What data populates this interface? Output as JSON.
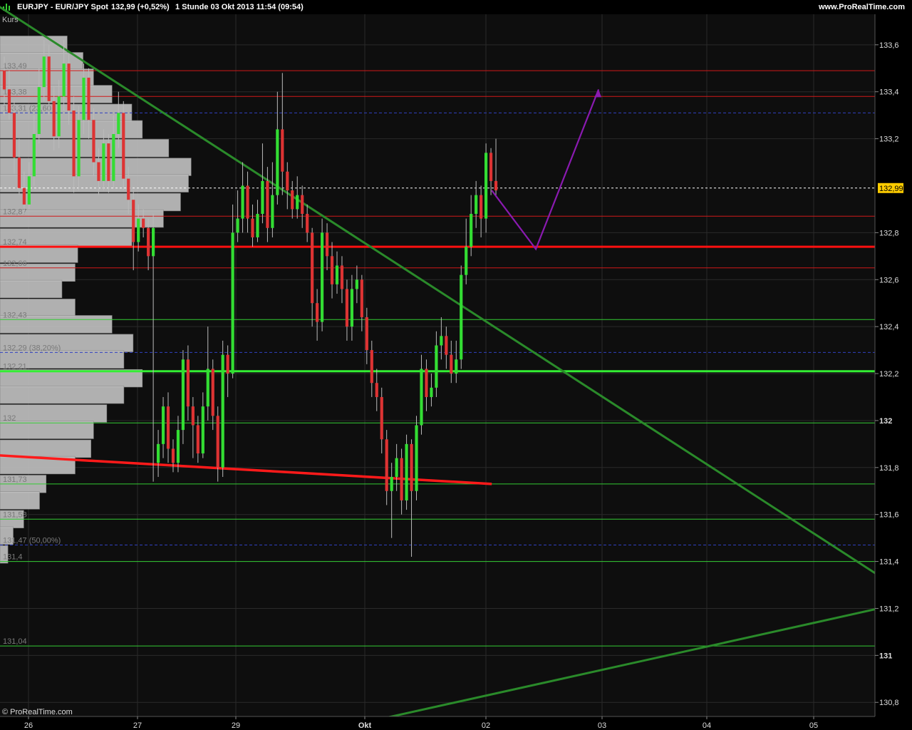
{
  "header": {
    "symbol": "EURJPY - EUR/JPY Spot",
    "price": "132,99 (+0,52%)",
    "timeframe": "1 Stunde  03 Okt 2013 11:54 (09:54)",
    "site": "www.ProRealTime.com"
  },
  "footer": {
    "copyright": "© ProRealTime.com"
  },
  "indicator_label": "Kurs",
  "colors": {
    "background": "#0e0e0e",
    "up_candle": "#33dd33",
    "down_candle": "#dd3333",
    "resistance": "#ff1a1a",
    "support": "#33dd33",
    "trendline": "#2a8a2a",
    "projection": "#8a1ab0",
    "price_tag": "#ffcc00"
  },
  "chart_data": {
    "type": "candlestick",
    "instrument": "EURJPY",
    "timeframe": "1 Stunde",
    "ylim": [
      130.74,
      133.73
    ],
    "y_ticks": [
      "133,6",
      "133,4",
      "133,2",
      "132,8",
      "132,6",
      "132,4",
      "132,2",
      "132",
      "131,8",
      "131,6",
      "131,4",
      "131,2",
      "131",
      "130,8"
    ],
    "x_ticks": [
      {
        "label": "26",
        "day": 0
      },
      {
        "label": "27",
        "day": 1
      },
      {
        "label": "29",
        "day": 2
      },
      {
        "label": "Okt",
        "day": 3
      },
      {
        "label": "02",
        "day": 4
      },
      {
        "label": "03",
        "day": 5
      },
      {
        "label": "04",
        "day": 6
      },
      {
        "label": "05",
        "day": 7
      }
    ],
    "last_price": {
      "label": "132,99",
      "value": 132.99
    },
    "candles": [
      [
        133.49,
        133.41,
        133.55,
        133.3
      ],
      [
        133.41,
        133.31,
        133.49,
        133.28
      ],
      [
        133.31,
        133.12,
        133.36,
        133.05
      ],
      [
        133.12,
        132.99,
        133.2,
        132.96
      ],
      [
        132.99,
        132.92,
        133.06,
        132.88
      ],
      [
        132.92,
        133.04,
        133.1,
        132.9
      ],
      [
        133.04,
        133.22,
        133.3,
        133.0
      ],
      [
        133.22,
        133.42,
        133.5,
        133.18
      ],
      [
        133.42,
        133.55,
        133.62,
        133.36
      ],
      [
        133.55,
        133.36,
        133.6,
        133.3
      ],
      [
        133.36,
        133.21,
        133.42,
        133.15
      ],
      [
        133.21,
        133.38,
        133.45,
        133.16
      ],
      [
        133.38,
        133.52,
        133.62,
        133.32
      ],
      [
        133.52,
        133.32,
        133.56,
        133.26
      ],
      [
        133.32,
        133.04,
        133.38,
        132.97
      ],
      [
        133.04,
        133.28,
        133.34,
        132.98
      ],
      [
        133.28,
        133.46,
        133.52,
        133.22
      ],
      [
        133.46,
        133.28,
        133.5,
        133.2
      ],
      [
        133.28,
        133.1,
        133.33,
        133.04
      ],
      [
        133.1,
        133.02,
        133.16,
        132.96
      ],
      [
        133.02,
        133.18,
        133.24,
        132.98
      ],
      [
        133.18,
        133.02,
        133.22,
        132.97
      ],
      [
        133.02,
        133.22,
        133.3,
        132.99
      ],
      [
        133.22,
        133.31,
        133.4,
        133.16
      ],
      [
        133.31,
        133.03,
        133.36,
        132.98
      ],
      [
        133.03,
        132.94,
        133.08,
        132.88
      ],
      [
        132.94,
        132.76,
        132.98,
        132.64
      ],
      [
        132.76,
        132.86,
        132.92,
        132.72
      ],
      [
        132.86,
        132.82,
        132.9,
        132.78
      ],
      [
        132.82,
        132.7,
        132.86,
        132.64
      ],
      [
        132.7,
        132.82,
        132.88,
        131.74
      ],
      [
        131.82,
        131.9,
        131.96,
        131.76
      ],
      [
        131.9,
        132.06,
        132.1,
        131.84
      ],
      [
        132.06,
        131.88,
        132.12,
        131.82
      ],
      [
        131.88,
        131.82,
        131.92,
        131.78
      ],
      [
        131.82,
        131.96,
        132.02,
        131.78
      ],
      [
        131.96,
        132.26,
        132.3,
        131.9
      ],
      [
        132.26,
        132.06,
        132.32,
        132.0
      ],
      [
        132.06,
        131.98,
        132.1,
        131.84
      ],
      [
        131.98,
        131.86,
        132.02,
        131.82
      ],
      [
        131.86,
        132.06,
        132.12,
        131.84
      ],
      [
        132.06,
        132.22,
        132.4,
        132.0
      ],
      [
        132.22,
        132.02,
        132.26,
        131.96
      ],
      [
        132.02,
        131.8,
        132.06,
        131.74
      ],
      [
        131.8,
        132.28,
        132.34,
        131.76
      ],
      [
        132.28,
        132.2,
        132.32,
        132.1
      ],
      [
        132.2,
        132.8,
        132.92,
        132.18
      ],
      [
        132.8,
        132.86,
        132.98,
        132.76
      ],
      [
        132.86,
        133.0,
        133.1,
        132.8
      ],
      [
        133.0,
        132.86,
        133.06,
        132.8
      ],
      [
        132.86,
        132.78,
        132.92,
        132.74
      ],
      [
        132.78,
        132.88,
        132.94,
        132.76
      ],
      [
        132.88,
        133.02,
        133.18,
        132.84
      ],
      [
        133.02,
        132.82,
        133.08,
        132.76
      ],
      [
        132.82,
        132.96,
        133.1,
        132.78
      ],
      [
        132.96,
        133.24,
        133.4,
        132.92
      ],
      [
        133.24,
        133.06,
        133.48,
        132.96
      ],
      [
        133.06,
        132.98,
        133.1,
        132.9
      ],
      [
        132.98,
        132.9,
        133.02,
        132.86
      ],
      [
        132.9,
        132.96,
        133.04,
        132.86
      ],
      [
        132.96,
        132.88,
        133.0,
        132.82
      ],
      [
        132.88,
        132.8,
        132.92,
        132.76
      ],
      [
        132.8,
        132.5,
        132.82,
        132.4
      ],
      [
        132.5,
        132.42,
        132.56,
        132.34
      ],
      [
        132.42,
        132.8,
        132.86,
        132.38
      ],
      [
        132.8,
        132.7,
        132.84,
        132.64
      ],
      [
        132.7,
        132.58,
        132.76,
        132.52
      ],
      [
        132.58,
        132.66,
        132.72,
        132.54
      ],
      [
        132.66,
        132.56,
        132.7,
        132.5
      ],
      [
        132.56,
        132.4,
        132.6,
        132.34
      ],
      [
        132.4,
        132.56,
        132.62,
        132.34
      ],
      [
        132.56,
        132.6,
        132.66,
        132.5
      ],
      [
        132.6,
        132.44,
        132.62,
        132.38
      ],
      [
        132.44,
        132.3,
        132.48,
        132.24
      ],
      [
        132.3,
        132.16,
        132.34,
        132.1
      ],
      [
        132.16,
        132.1,
        132.22,
        132.04
      ],
      [
        132.1,
        131.92,
        132.14,
        131.86
      ],
      [
        131.92,
        131.7,
        131.96,
        131.64
      ],
      [
        131.7,
        131.76,
        131.82,
        131.5
      ],
      [
        131.76,
        131.84,
        131.9,
        131.7
      ],
      [
        131.84,
        131.66,
        131.88,
        131.6
      ],
      [
        131.66,
        131.9,
        131.94,
        131.62
      ],
      [
        131.9,
        131.7,
        131.92,
        131.42
      ],
      [
        131.7,
        131.98,
        132.02,
        131.66
      ],
      [
        131.98,
        132.22,
        132.28,
        131.94
      ],
      [
        132.22,
        132.1,
        132.26,
        132.04
      ],
      [
        132.1,
        132.14,
        132.2,
        132.06
      ],
      [
        132.14,
        132.32,
        132.38,
        132.1
      ],
      [
        132.32,
        132.36,
        132.44,
        132.26
      ],
      [
        132.36,
        132.28,
        132.4,
        132.22
      ],
      [
        132.28,
        132.2,
        132.34,
        132.16
      ],
      [
        132.2,
        132.26,
        132.34,
        132.16
      ],
      [
        132.26,
        132.62,
        132.66,
        132.22
      ],
      [
        132.62,
        132.74,
        132.86,
        132.58
      ],
      [
        132.74,
        132.88,
        132.96,
        132.7
      ],
      [
        132.88,
        132.96,
        133.02,
        132.82
      ],
      [
        132.96,
        132.86,
        133.0,
        132.78
      ],
      [
        132.86,
        133.14,
        133.18,
        132.8
      ],
      [
        133.14,
        133.02,
        133.16,
        132.96
      ],
      [
        133.02,
        132.98,
        133.2,
        132.96
      ]
    ],
    "horizontal_levels": [
      {
        "value": 133.49,
        "kind": "resistance",
        "label": "133,49"
      },
      {
        "value": 133.38,
        "kind": "resistance",
        "label": "133,38"
      },
      {
        "value": 133.31,
        "kind": "fib",
        "label": "133,31 (23,60"
      },
      {
        "value": 132.99,
        "kind": "last",
        "label": ""
      },
      {
        "value": 132.87,
        "kind": "resistance",
        "label": "132,87"
      },
      {
        "value": 132.74,
        "kind": "major-resistance",
        "label": "132,74"
      },
      {
        "value": 132.65,
        "kind": "resistance",
        "label": "132,66"
      },
      {
        "value": 132.43,
        "kind": "support",
        "label": "132,43"
      },
      {
        "value": 132.29,
        "kind": "fib",
        "label": "132,29 (38,20%)"
      },
      {
        "value": 132.21,
        "kind": "major-support",
        "label": "132,21"
      },
      {
        "value": 131.99,
        "kind": "support",
        "label": "132"
      },
      {
        "value": 131.73,
        "kind": "support",
        "label": "131,73"
      },
      {
        "value": 131.58,
        "kind": "support",
        "label": "131,58"
      },
      {
        "value": 131.47,
        "kind": "fib",
        "label": "131,47 (50,00%)"
      },
      {
        "value": 131.4,
        "kind": "support",
        "label": "131,4"
      },
      {
        "value": 131.04,
        "kind": "support",
        "label": "131,04"
      }
    ],
    "trendlines": [
      {
        "kind": "down-trend",
        "from": [
          -0.96,
          133.97
        ],
        "to": [
          7.61,
          131.34
        ]
      },
      {
        "kind": "up-trend",
        "from": [
          3.05,
          130.72
        ],
        "to": [
          7.61,
          131.2
        ]
      },
      {
        "kind": "red-support",
        "from": [
          -0.96,
          131.87
        ],
        "to": [
          4.05,
          131.73
        ]
      }
    ],
    "projection": [
      [
        4.05,
        132.98
      ],
      [
        4.43,
        132.73
      ],
      [
        4.97,
        133.41
      ]
    ],
    "volume_profile": [
      {
        "price": 133.6,
        "width": 0.51
      },
      {
        "price": 133.53,
        "width": 0.63
      },
      {
        "price": 133.46,
        "width": 0.71
      },
      {
        "price": 133.39,
        "width": 0.85
      },
      {
        "price": 133.31,
        "width": 1.0
      },
      {
        "price": 133.24,
        "width": 1.08
      },
      {
        "price": 133.16,
        "width": 1.28
      },
      {
        "price": 133.08,
        "width": 1.45
      },
      {
        "price": 133.01,
        "width": 1.43
      },
      {
        "price": 132.93,
        "width": 1.37
      },
      {
        "price": 132.86,
        "width": 1.24
      },
      {
        "price": 132.78,
        "width": 1.0
      },
      {
        "price": 132.71,
        "width": 0.59
      },
      {
        "price": 132.63,
        "width": 0.57
      },
      {
        "price": 132.56,
        "width": 0.47
      },
      {
        "price": 132.48,
        "width": 0.57
      },
      {
        "price": 132.41,
        "width": 0.85
      },
      {
        "price": 132.33,
        "width": 1.01
      },
      {
        "price": 132.26,
        "width": 0.94
      },
      {
        "price": 132.18,
        "width": 1.08
      },
      {
        "price": 132.11,
        "width": 0.94
      },
      {
        "price": 132.03,
        "width": 0.81
      },
      {
        "price": 131.96,
        "width": 0.71
      },
      {
        "price": 131.88,
        "width": 0.69
      },
      {
        "price": 131.81,
        "width": 0.57
      },
      {
        "price": 131.73,
        "width": 0.35
      },
      {
        "price": 131.66,
        "width": 0.3
      },
      {
        "price": 131.58,
        "width": 0.18
      },
      {
        "price": 131.51,
        "width": 0.1
      },
      {
        "price": 131.43,
        "width": 0.06
      }
    ]
  }
}
